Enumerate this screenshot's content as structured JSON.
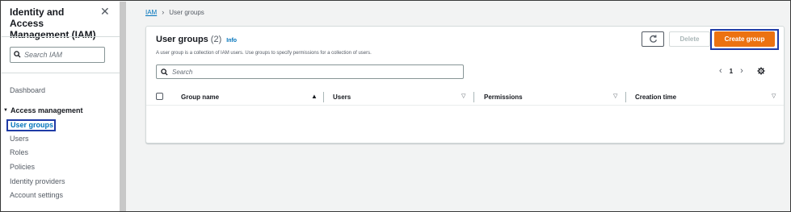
{
  "sidebar": {
    "title": "Identity and Access Management (IAM)",
    "close_icon": "close-icon",
    "search_placeholder": "Search IAM",
    "dashboard_label": "Dashboard",
    "section_label": "Access management",
    "items": [
      {
        "label": "User groups",
        "active": true
      },
      {
        "label": "Users"
      },
      {
        "label": "Roles"
      },
      {
        "label": "Policies"
      },
      {
        "label": "Identity providers"
      },
      {
        "label": "Account settings"
      }
    ]
  },
  "breadcrumb": {
    "root": "IAM",
    "current": "User groups"
  },
  "panel": {
    "title": "User groups",
    "count": "(2)",
    "info_label": "Info",
    "description": "A user group is a collection of IAM users. Use groups to specify permissions for a collection of users.",
    "delete_label": "Delete",
    "create_label": "Create group",
    "search_placeholder": "Search",
    "page_number": "1"
  },
  "table": {
    "columns": [
      "Group name",
      "Users",
      "Permissions",
      "Creation time"
    ],
    "rows": []
  },
  "colors": {
    "accent": "#ec7211",
    "link": "#0073bb",
    "highlight_outline": "#1f3ba6"
  }
}
